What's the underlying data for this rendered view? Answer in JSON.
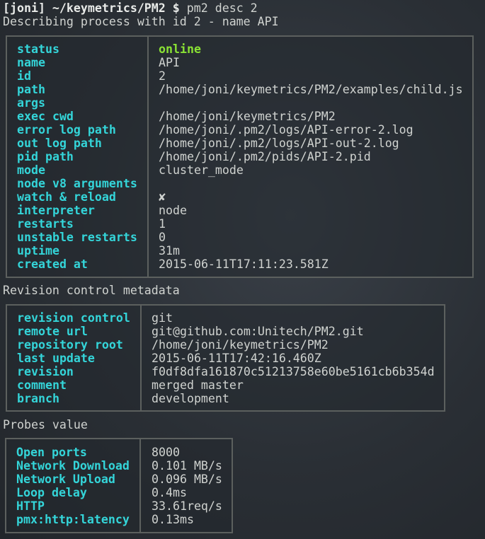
{
  "prompt": {
    "user": "[joni] ~/keymetrics/PM2 $",
    "command": " pm2 desc 2"
  },
  "describing": "Describing process with id 2 - name API",
  "process": [
    {
      "k": "status",
      "v": "online"
    },
    {
      "k": "name",
      "v": "API"
    },
    {
      "k": "id",
      "v": "2"
    },
    {
      "k": "path",
      "v": "/home/joni/keymetrics/PM2/examples/child.js"
    },
    {
      "k": "args",
      "v": ""
    },
    {
      "k": "exec cwd",
      "v": "/home/joni/keymetrics/PM2"
    },
    {
      "k": "error log path",
      "v": "/home/joni/.pm2/logs/API-error-2.log"
    },
    {
      "k": "out log path",
      "v": "/home/joni/.pm2/logs/API-out-2.log"
    },
    {
      "k": "pid path",
      "v": "/home/joni/.pm2/pids/API-2.pid"
    },
    {
      "k": "mode",
      "v": "cluster_mode"
    },
    {
      "k": "node v8 arguments",
      "v": ""
    },
    {
      "k": "watch & reload",
      "v": "✘"
    },
    {
      "k": "interpreter",
      "v": "node"
    },
    {
      "k": "restarts",
      "v": "1"
    },
    {
      "k": "unstable restarts",
      "v": "0"
    },
    {
      "k": "uptime",
      "v": "31m"
    },
    {
      "k": "created at",
      "v": "2015-06-11T17:11:23.581Z"
    }
  ],
  "revision_title": "Revision control metadata",
  "revision": [
    {
      "k": "revision control",
      "v": "git"
    },
    {
      "k": "remote url",
      "v": "git@github.com:Unitech/PM2.git"
    },
    {
      "k": "repository root",
      "v": "/home/joni/keymetrics/PM2"
    },
    {
      "k": "last update",
      "v": "2015-06-11T17:42:16.460Z"
    },
    {
      "k": "revision",
      "v": "f0df8dfa161870c51213758e60be5161cb6b354d"
    },
    {
      "k": "comment",
      "v": "merged master"
    },
    {
      "k": "branch",
      "v": "development"
    }
  ],
  "probes_title": "Probes value",
  "probes": [
    {
      "k": "Open ports",
      "v": "8000"
    },
    {
      "k": "Network Download",
      "v": "0.101 MB/s"
    },
    {
      "k": "Network Upload",
      "v": "0.096 MB/s"
    },
    {
      "k": "Loop delay",
      "v": "0.4ms"
    },
    {
      "k": "HTTP",
      "v": "33.61req/s"
    },
    {
      "k": "pmx:http:latency",
      "v": "0.13ms"
    }
  ],
  "colors": {
    "key": "#34d5d9",
    "online": "#8ae234"
  }
}
